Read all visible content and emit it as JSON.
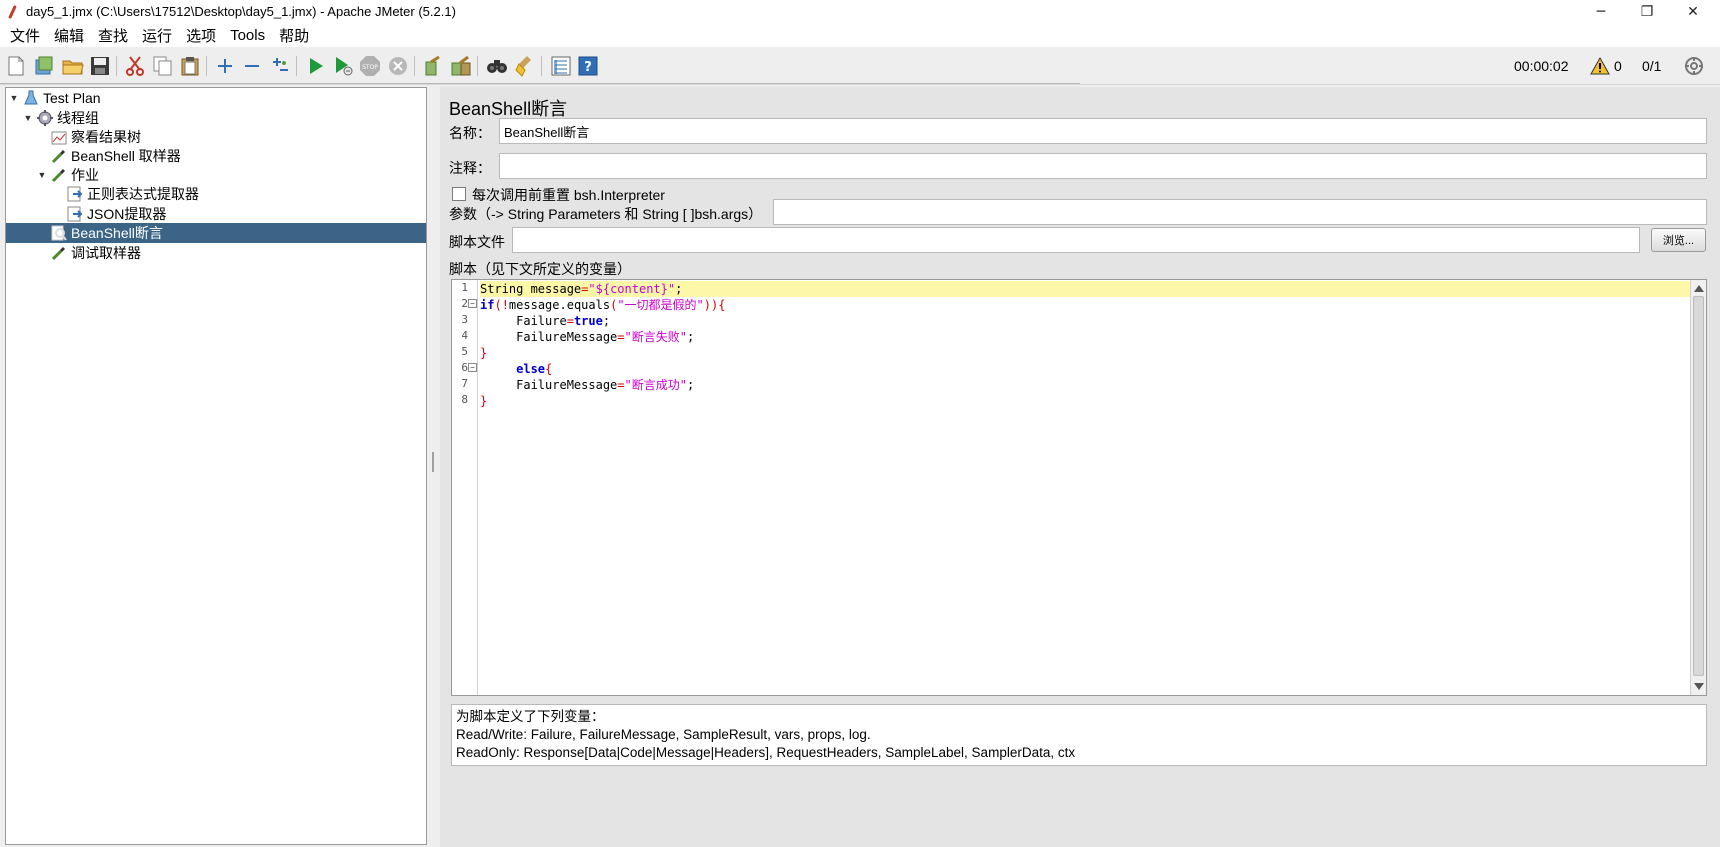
{
  "window": {
    "title": "day5_1.jmx (C:\\Users\\17512\\Desktop\\day5_1.jmx) - Apache JMeter (5.2.1)",
    "controls": {
      "minimize": "─",
      "restore": "❐",
      "close": "✕"
    }
  },
  "menu": {
    "items": [
      "文件",
      "编辑",
      "查找",
      "运行",
      "选项",
      "Tools",
      "帮助"
    ]
  },
  "toolbar": {
    "icons": [
      "new-icon",
      "templates-icon",
      "open-icon",
      "save-icon",
      "cut-icon",
      "copy-icon",
      "paste-icon",
      "expand-icon",
      "collapse-icon",
      "toggle-icon",
      "start-icon",
      "start-no-pause-icon",
      "stop-icon",
      "shutdown-icon",
      "clear-icon",
      "clear-all-icon",
      "search-icon",
      "reset-search-icon",
      "function-helper-icon",
      "help-icon"
    ],
    "timer": "00:00:02",
    "warning_count": "0",
    "threads": "0/1"
  },
  "tree": {
    "nodes": [
      {
        "label": "Test Plan",
        "level": 0,
        "icon": "test-plan-icon",
        "expanded": true
      },
      {
        "label": "线程组",
        "level": 1,
        "icon": "thread-group-icon",
        "expanded": true
      },
      {
        "label": "察看结果树",
        "level": 2,
        "icon": "listener-icon"
      },
      {
        "label": "BeanShell 取样器",
        "level": 2,
        "icon": "sampler-icon"
      },
      {
        "label": "作业",
        "level": 2,
        "icon": "sampler-icon",
        "expanded": true
      },
      {
        "label": "正则表达式提取器",
        "level": 3,
        "icon": "extractor-icon"
      },
      {
        "label": "JSON提取器",
        "level": 3,
        "icon": "extractor-icon"
      },
      {
        "label": "BeanShell断言",
        "level": 2,
        "icon": "assertion-icon",
        "selected": true
      },
      {
        "label": "调试取样器",
        "level": 2,
        "icon": "sampler-icon"
      }
    ]
  },
  "panel": {
    "title": "BeanShell断言",
    "name_label": "名称：",
    "name_value": "BeanShell断言",
    "comment_label": "注释：",
    "comment_value": "",
    "reset_label": "每次调用前重置 bsh.Interpreter",
    "params_label": "参数（-> String Parameters 和 String [ ]bsh.args）",
    "params_value": "",
    "script_file_label": "脚本文件",
    "script_file_value": "",
    "browse_label": "浏览...",
    "script_label": "脚本（见下文所定义的变量）"
  },
  "script": {
    "line_numbers": [
      "1",
      "2",
      "3",
      "4",
      "5",
      "6",
      "7",
      "8"
    ],
    "lines": [
      "String message=\"${content}\";",
      "if(!message.equals(\"一切都是假的\")){",
      "     Failure=true;",
      "     FailureMessage=\"断言失败\";",
      "}",
      "     else{",
      "     FailureMessage=\"断言成功\";",
      "}"
    ]
  },
  "vars": {
    "line1": "为脚本定义了下列变量：",
    "line2": "Read/Write: Failure, FailureMessage, SampleResult, vars, props, log.",
    "line3": "ReadOnly: Response[Data|Code|Message|Headers], RequestHeaders, SampleLabel, SamplerData, ctx"
  }
}
